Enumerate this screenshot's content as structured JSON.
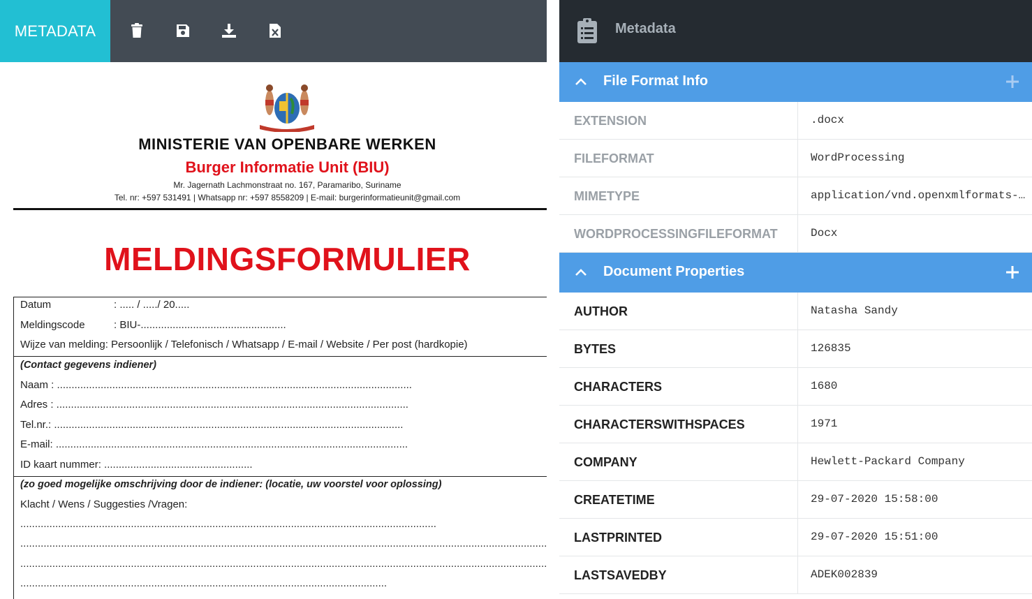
{
  "toolbar": {
    "tab_label": "METADATA",
    "icons": [
      "trash-icon",
      "save-icon",
      "download-icon",
      "excel-file-icon"
    ]
  },
  "document": {
    "ministry": "MINISTERIE VAN OPENBARE WERKEN",
    "unit": "Burger Informatie Unit (BIU)",
    "address": "Mr. Jagernath Lachmonstraat no. 167, Paramaribo, Suriname",
    "contact": "Tel. nr: +597 531491 | Whatsapp nr: +597 8558209 | E-mail: burgerinformatieunit@gmail.com",
    "form_title": "MELDINGSFORMULIER",
    "datum_label": "Datum",
    "datum_value": ": ..... / ...../ 20.....",
    "code_label": "Meldingscode",
    "code_value": ": BIU-..................................................",
    "wijze": "Wijze van melding: Persoonlijk / Telefonisch / Whatsapp / E-mail / Website / Per post (hardkopie)",
    "contact_heading": "(Contact gegevens indiener)",
    "naam": "Naam : ..........................................................................................................................",
    "adres": "Adres : .........................................................................................................................",
    "tel": "Tel.nr.: ........................................................................................................................",
    "email": "E-mail: .........................................................................................................................",
    "idkaart": "ID kaart nummer:  ...................................................",
    "omschrijving_heading": "(zo goed mogelijke omschrijving door de indiener: (locatie, uw voorstel voor oplossing)",
    "klacht": "Klacht / Wens / Suggesties /Vragen:",
    "dots1": "...............................................................................................................................................",
    "dots2": "...........................................................................................................................................................................................................",
    "dots3": "...........................................................................................................................................................................................................",
    "dots4": ".............................................................................................................................."
  },
  "metadata_panel": {
    "title": "Metadata",
    "sections": [
      {
        "title": "File Format Info",
        "rows": [
          {
            "key": "EXTENSION",
            "value": ".docx"
          },
          {
            "key": "FILEFORMAT",
            "value": "WordProcessing"
          },
          {
            "key": "MIMETYPE",
            "value": "application/vnd.openxmlformats-officedocument.wordprocessingml.document"
          },
          {
            "key": "WORDPROCESSINGFILEFORMAT",
            "value": "Docx"
          }
        ]
      },
      {
        "title": "Document Properties",
        "rows": [
          {
            "key": "AUTHOR",
            "value": "Natasha Sandy"
          },
          {
            "key": "BYTES",
            "value": "126835"
          },
          {
            "key": "CHARACTERS",
            "value": "1680"
          },
          {
            "key": "CHARACTERSWITHSPACES",
            "value": "1971"
          },
          {
            "key": "COMPANY",
            "value": "Hewlett-Packard Company"
          },
          {
            "key": "CREATETIME",
            "value": "29-07-2020 15:58:00"
          },
          {
            "key": "LASTPRINTED",
            "value": "29-07-2020 15:51:00"
          },
          {
            "key": "LASTSAVEDBY",
            "value": "ADEK002839"
          }
        ]
      }
    ]
  },
  "colors": {
    "accent_tab": "#22bfd3",
    "toolbar_bg": "#434b54",
    "panel_header_bg": "#252b31",
    "section_bg": "#4f9de6",
    "doc_red": "#e0121b"
  }
}
